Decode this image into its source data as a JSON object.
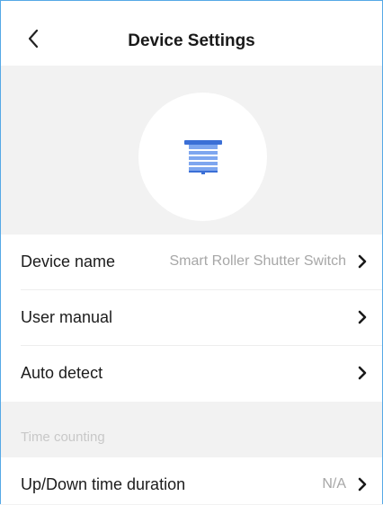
{
  "header": {
    "title": "Device Settings"
  },
  "device_icon": {
    "icon": "roller-shutter-icon",
    "color": "#4a84e4"
  },
  "rows": [
    {
      "label": "Device name",
      "value": "Smart Roller Shutter Switch"
    },
    {
      "label": "User manual",
      "value": ""
    },
    {
      "label": "Auto detect",
      "value": ""
    }
  ],
  "section": {
    "label": "Time counting"
  },
  "time_row": {
    "label": "Up/Down time duration",
    "value": "N/A"
  },
  "icons": {
    "back": "back-chevron-icon",
    "row_arrow": "chevron-right-icon"
  }
}
